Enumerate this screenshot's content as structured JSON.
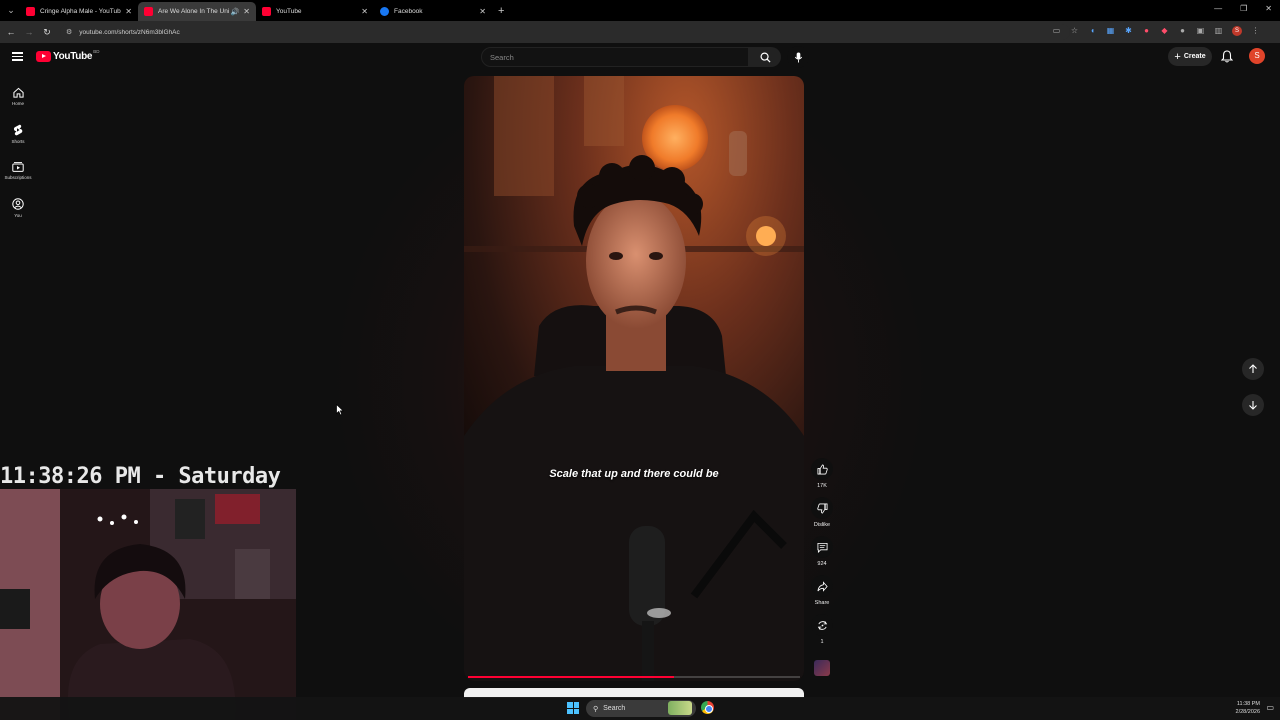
{
  "browser": {
    "tabs": [
      {
        "title": "Cringe Alpha Male - YouTube",
        "favicon": "youtube-icon",
        "active": false
      },
      {
        "title": "Are We Alone In The Unive",
        "favicon": "youtube-icon",
        "active": true,
        "audio": true
      },
      {
        "title": "YouTube",
        "favicon": "youtube-icon",
        "active": false
      },
      {
        "title": "Facebook",
        "favicon": "facebook-icon",
        "active": false
      }
    ],
    "url": "youtube.com/shorts/zN6m3blGhAc",
    "profile_initial": "S"
  },
  "youtube": {
    "logo_text": "YouTube",
    "region_code": "BD",
    "search_placeholder": "Search",
    "create_label": "Create",
    "account_initial": "S",
    "sidebar": [
      {
        "label": "Home",
        "icon": "home-icon"
      },
      {
        "label": "Shorts",
        "icon": "shorts-icon"
      },
      {
        "label": "Subscriptions",
        "icon": "subscriptions-icon"
      },
      {
        "label": "You",
        "icon": "you-icon"
      }
    ],
    "short": {
      "caption": "Scale that up and there could be",
      "progress": 0.62
    },
    "actions": {
      "like_count": "17K",
      "dislike_label": "Dislike",
      "comment_count": "924",
      "share_label": "Share",
      "remix_count": "1"
    }
  },
  "overlay": {
    "clock_text": "11:38:26 PM - Saturday"
  },
  "taskbar": {
    "search_label": "Search",
    "time": "11:38 PM",
    "date": "2/28/2026"
  },
  "colors": {
    "youtube_red": "#ff0033",
    "background": "#0f0f0f",
    "windows_accent": "#4cc2ff"
  }
}
